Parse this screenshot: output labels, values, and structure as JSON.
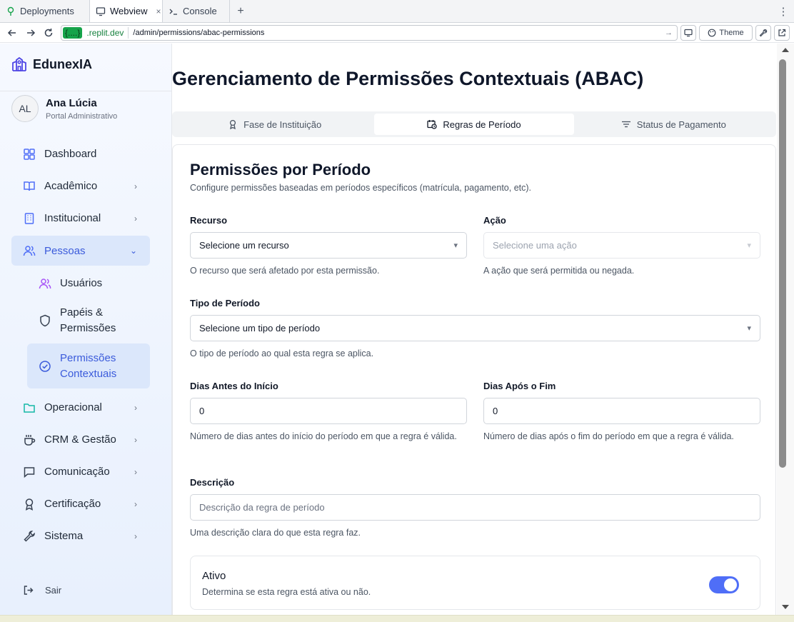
{
  "browser": {
    "tabs": [
      {
        "label": "Deployments",
        "icon": "deploy-icon"
      },
      {
        "label": "Webview",
        "icon": "monitor-icon",
        "close": "×"
      },
      {
        "label": "Console",
        "icon": "terminal-icon"
      }
    ],
    "add_tab": "+",
    "menu": "⋮",
    "url_badge": "{....}",
    "url_host": ".replit.dev",
    "url_path": "/admin/permissions/abac-permissions",
    "theme_label": "Theme"
  },
  "sidebar": {
    "brand": "EdunexIA",
    "user": {
      "initials": "AL",
      "name": "Ana Lúcia",
      "role": "Portal Administrativo"
    },
    "items": [
      {
        "label": "Dashboard"
      },
      {
        "label": "Acadêmico"
      },
      {
        "label": "Institucional"
      },
      {
        "label": "Pessoas"
      },
      {
        "label": "Usuários"
      },
      {
        "label": "Papéis & Permissões"
      },
      {
        "label": "Permissões Contextuais"
      },
      {
        "label": "Operacional"
      },
      {
        "label": "CRM & Gestão"
      },
      {
        "label": "Comunicação"
      },
      {
        "label": "Certificação"
      },
      {
        "label": "Sistema"
      }
    ],
    "logout": "Sair"
  },
  "page": {
    "title": "Gerenciamento de Permissões Contextuais (ABAC)",
    "tabs": [
      {
        "label": "Fase de Instituição"
      },
      {
        "label": "Regras de Período"
      },
      {
        "label": "Status de Pagamento"
      }
    ]
  },
  "form": {
    "title": "Permissões por Período",
    "description": "Configure permissões baseadas em períodos específicos (matrícula, pagamento, etc).",
    "resource": {
      "label": "Recurso",
      "value": "Selecione um recurso",
      "help": "O recurso que será afetado por esta permissão."
    },
    "action": {
      "label": "Ação",
      "placeholder": "Selecione uma ação",
      "help": "A ação que será permitida ou negada."
    },
    "period_type": {
      "label": "Tipo de Período",
      "value": "Selecione um tipo de período",
      "help": "O tipo de período ao qual esta regra se aplica."
    },
    "days_before": {
      "label": "Dias Antes do Início",
      "value": "0",
      "help": "Número de dias antes do início do período em que a regra é válida."
    },
    "days_after": {
      "label": "Dias Após o Fim",
      "value": "0",
      "help": "Número de dias após o fim do período em que a regra é válida."
    },
    "description_field": {
      "label": "Descrição",
      "placeholder": "Descrição da regra de período",
      "help": "Uma descrição clara do que esta regra faz."
    },
    "active": {
      "title": "Ativo",
      "description": "Determina se esta regra está ativa ou não.",
      "checked": true
    }
  },
  "colors": {
    "accent": "#4f6ef7",
    "active_nav_bg": "#dbe7fb",
    "active_nav_text": "#3b5bdb"
  }
}
